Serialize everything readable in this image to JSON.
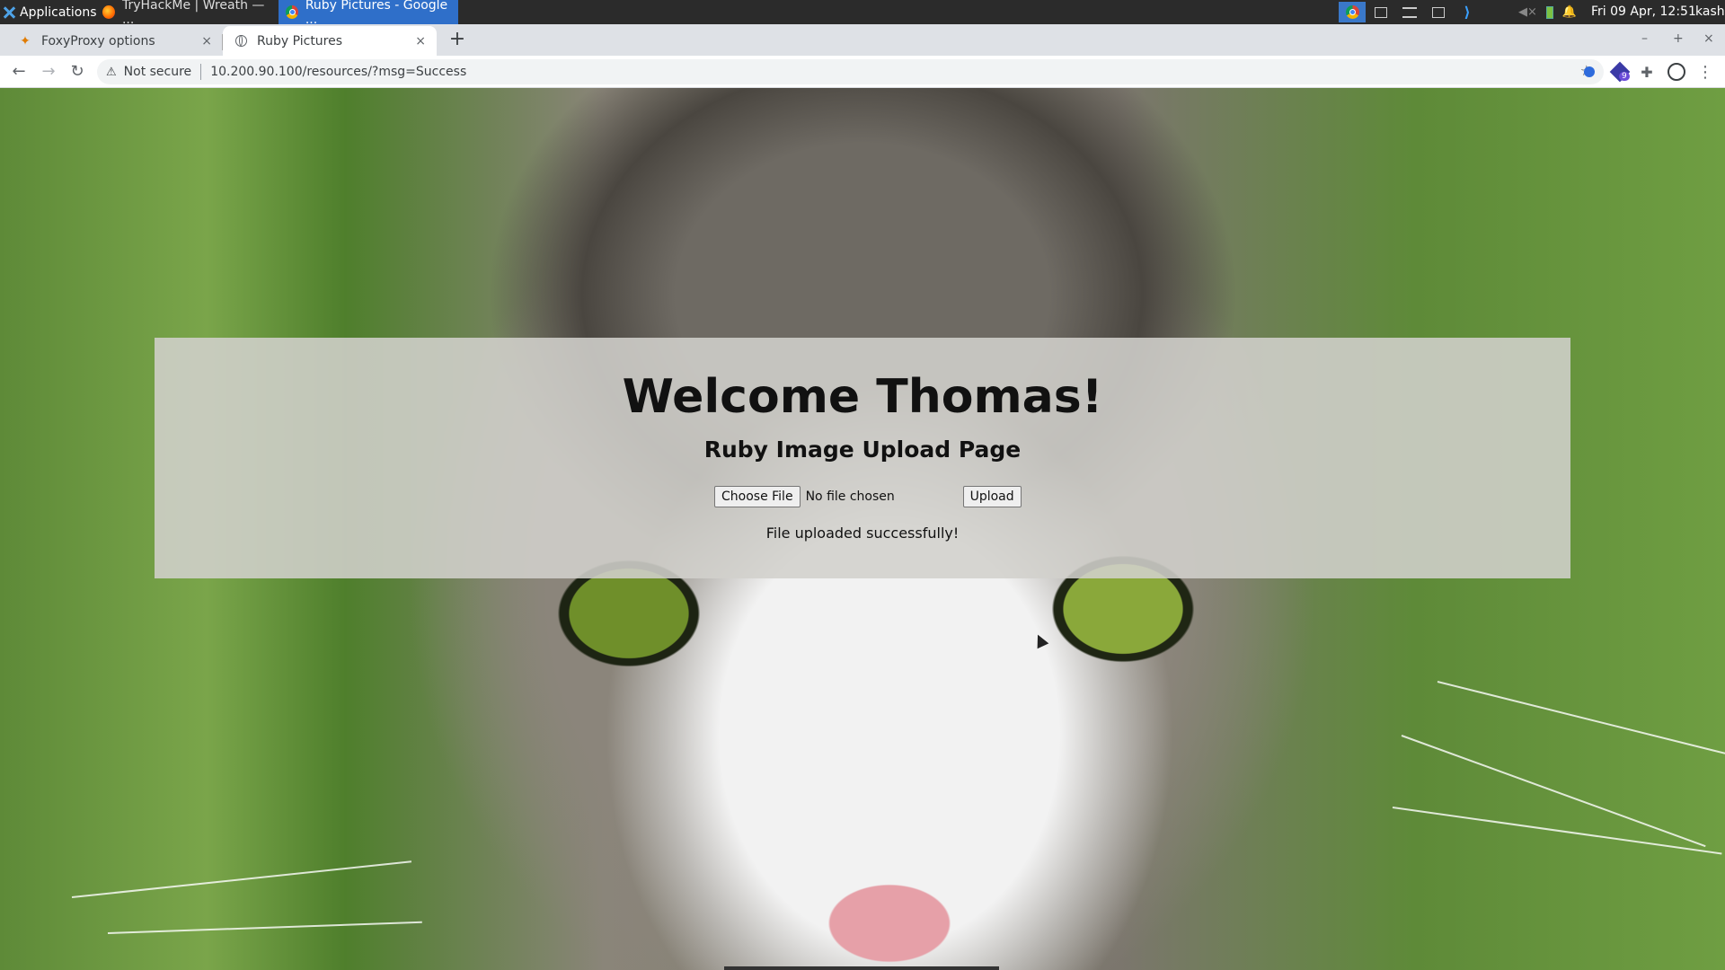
{
  "taskbar": {
    "apps_label": "Applications",
    "tasks": [
      {
        "label": "TryHackMe | Wreath — ..."
      },
      {
        "label": "Ruby Pictures - Google ..."
      }
    ],
    "clock": "Fri 09 Apr, 12:51",
    "user": "kash"
  },
  "browser": {
    "tabs": [
      {
        "title": "FoxyProxy options",
        "close": "×"
      },
      {
        "title": "Ruby Pictures",
        "close": "×"
      }
    ],
    "new_tab": "+",
    "window_controls": {
      "minimize": "–",
      "maximize": "+",
      "close": "×"
    },
    "security_label": "Not secure",
    "url_host": "10.200.90.100",
    "url_path": "/resources/?msg=Success",
    "extension_badge": "9"
  },
  "page": {
    "heading": "Welcome Thomas!",
    "subheading": "Ruby Image Upload Page",
    "choose_file_label": "Choose File",
    "file_status": "No file chosen",
    "upload_label": "Upload",
    "message": "File uploaded successfully!"
  },
  "colors": {
    "taskbar_bg": "#2b2b2b",
    "active_task": "#2f6fc9",
    "tabstrip_bg": "#dee1e6",
    "panel_bg": "#d2d0cc"
  },
  "icons": [
    "xfce-logo-icon",
    "firefox-icon",
    "chrome-icon",
    "foxyproxy-icon",
    "globe-icon",
    "back-icon",
    "forward-icon",
    "reload-icon",
    "warning-icon",
    "star-icon",
    "extension-icon",
    "puzzle-icon",
    "profile-icon",
    "menu-icon",
    "mouse-cursor-icon"
  ]
}
